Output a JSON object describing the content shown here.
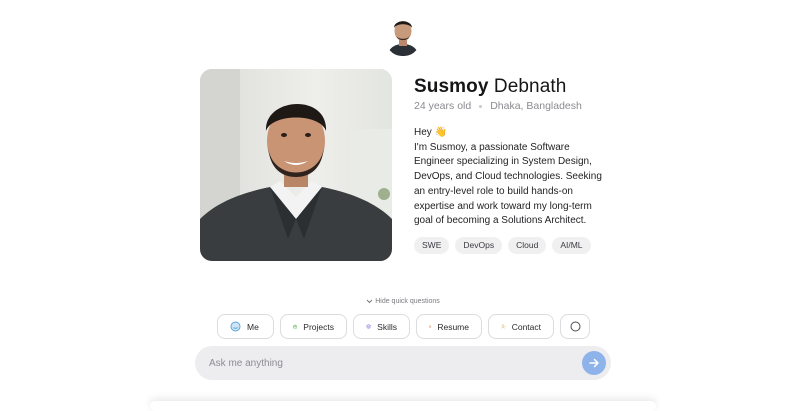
{
  "profile": {
    "first_name": "Susmoy",
    "last_name": "Debnath",
    "age": "24 years old",
    "location": "Dhaka, Bangladesh",
    "greeting": "Hey 👋",
    "bio": "I'm Susmoy, a passionate Software Engineer specializing in System Design, DevOps, and Cloud technologies. Seeking an entry-level role to build hands-on expertise and work toward my long-term goal of becoming a Solutions Architect."
  },
  "tags": [
    "SWE",
    "DevOps",
    "Cloud",
    "AI/ML"
  ],
  "quick_questions": {
    "toggle_label": "Hide quick questions",
    "buttons": [
      {
        "label": "Me",
        "icon": "smile-icon"
      },
      {
        "label": "Projects",
        "icon": "briefcase-icon"
      },
      {
        "label": "Skills",
        "icon": "layers-icon"
      },
      {
        "label": "Resume",
        "icon": "document-icon"
      },
      {
        "label": "Contact",
        "icon": "user-contact-icon"
      },
      {
        "label": "",
        "icon": "circle-more-icon"
      }
    ]
  },
  "chat": {
    "placeholder": "Ask me anything",
    "send_icon": "arrow-right-icon"
  },
  "colors": {
    "accent": "#8eb3ea",
    "chat_bg": "#ededf0",
    "tag_bg": "#f0f0f1"
  }
}
